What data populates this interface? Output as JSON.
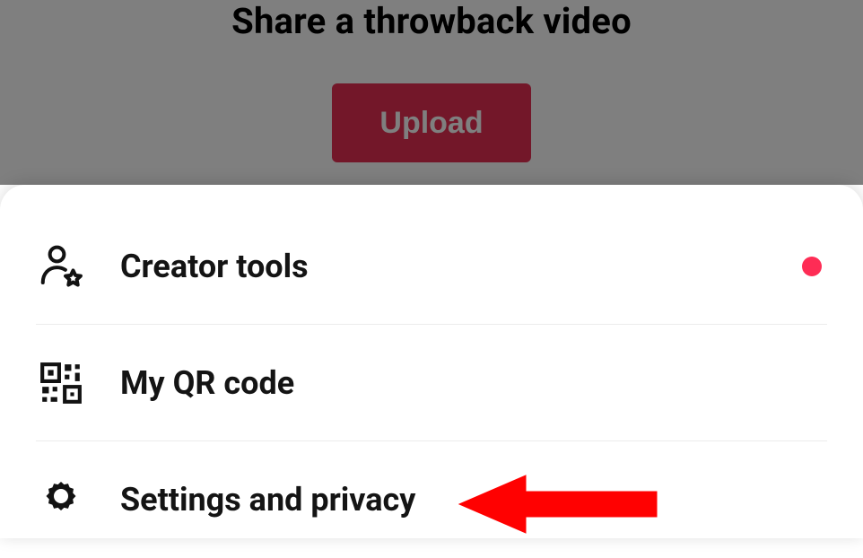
{
  "background": {
    "prompt_title": "Share a throwback video",
    "upload_label": "Upload"
  },
  "menu": {
    "items": [
      {
        "label": "Creator tools",
        "has_notification": true
      },
      {
        "label": "My QR code",
        "has_notification": false
      },
      {
        "label": "Settings and privacy",
        "has_notification": false
      }
    ]
  },
  "colors": {
    "accent": "#fe2c55",
    "upload_btn": "#e62e53",
    "annotation_arrow": "#ff0000"
  }
}
